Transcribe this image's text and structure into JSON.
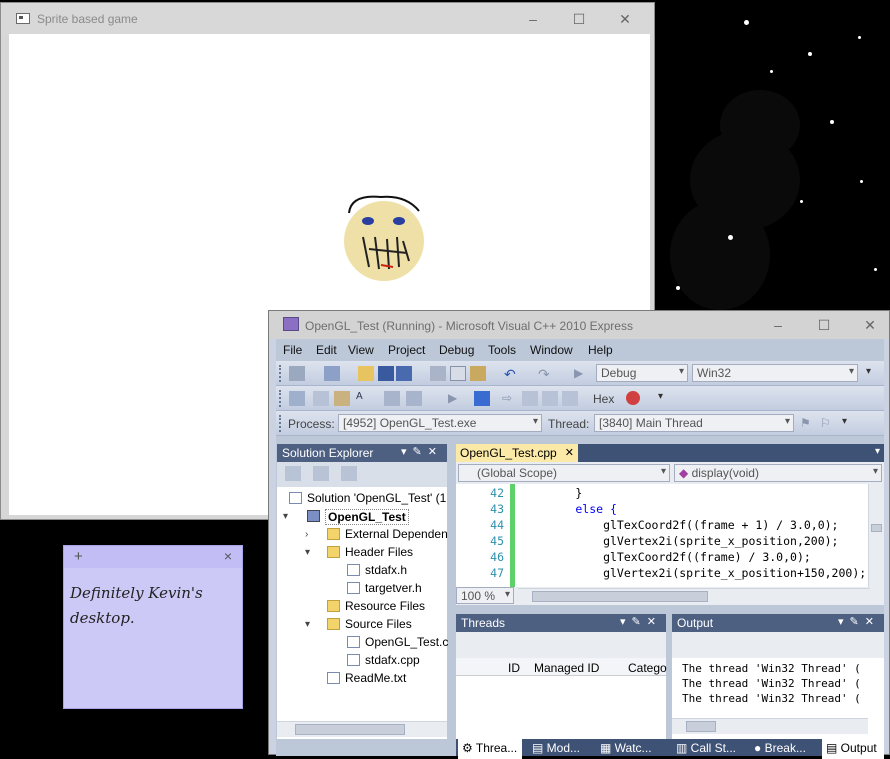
{
  "game_window": {
    "title": "Sprite based game",
    "minimize": "–",
    "maximize": "☐",
    "close": "✕"
  },
  "sticky_note": {
    "add": "+",
    "close": "×",
    "text": "Definitely Kevin's desktop."
  },
  "vs_window": {
    "title": "OpenGL_Test (Running) - Microsoft Visual C++ 2010 Express",
    "minimize": "–",
    "maximize": "☐",
    "close": "✕",
    "menu": [
      "File",
      "Edit",
      "View",
      "Project",
      "Debug",
      "Tools",
      "Window",
      "Help"
    ],
    "toolbar": {
      "config": "Debug",
      "platform": "Win32",
      "hex": "Hex",
      "process_label": "Process:",
      "process_value": "[4952] OpenGL_Test.exe",
      "thread_label": "Thread:",
      "thread_value": "[3840] Main Thread"
    },
    "solution_explorer": {
      "title": "Solution Explorer",
      "items": [
        "Solution 'OpenGL_Test' (1",
        "OpenGL_Test",
        "External Dependen",
        "Header Files",
        "stdafx.h",
        "targetver.h",
        "Resource Files",
        "Source Files",
        "OpenGL_Test.c",
        "stdafx.cpp",
        "ReadMe.txt"
      ]
    },
    "editor": {
      "tab": "OpenGL_Test.cpp",
      "scope": "(Global Scope)",
      "function": "display(void)",
      "zoom": "100 %",
      "lines": [
        {
          "n": "42",
          "code": "        }"
        },
        {
          "n": "43",
          "code": "        else {"
        },
        {
          "n": "44",
          "code": "            glTexCoord2f((frame + 1) / 3.0,0);"
        },
        {
          "n": "45",
          "code": "            glVertex2i(sprite_x_position,200);"
        },
        {
          "n": "46",
          "code": "            glTexCoord2f((frame) / 3.0,0);"
        },
        {
          "n": "47",
          "code": "            glVertex2i(sprite_x_position+150,200);"
        }
      ]
    },
    "threads": {
      "title": "Threads",
      "columns": [
        "ID",
        "Managed ID",
        "Catego"
      ]
    },
    "output": {
      "title": "Output",
      "lines": [
        "The thread 'Win32 Thread' (",
        "The thread 'Win32 Thread' (",
        "The thread 'Win32 Thread' ("
      ]
    },
    "bottom_tabs": [
      "Threa...",
      "Mod...",
      "Watc...",
      "Call St...",
      "Break...",
      "Output"
    ]
  },
  "colors": {
    "vs_frame": "#bcc7d8",
    "panel_title": "#4d6082",
    "sticky": "#cdc9f7",
    "face": "#efe0a8"
  }
}
